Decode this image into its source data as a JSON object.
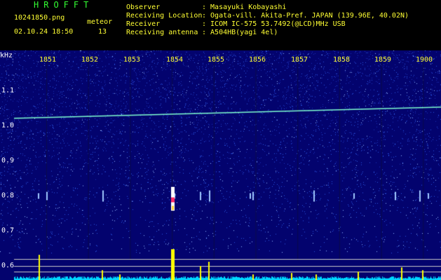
{
  "header": {
    "brand": "HROFFT",
    "filename": "10241850.png",
    "datetime": "02.10.24 18:50",
    "meteor_label": "meteor",
    "meteor_count": "13",
    "fields": [
      {
        "label": "Observer",
        "value": ": Masayuki Kobayashi"
      },
      {
        "label": "Receiving Location",
        "value": ": Ogata-vill. Akita-Pref. JAPAN (139.96E, 40.02N)"
      },
      {
        "label": "Receiver",
        "value": ": ICOM IC-575 53.7492(@LCD)MHz USB"
      },
      {
        "label": "Receiving antenna",
        "value": ": A504HB(yagi 4el)"
      }
    ]
  },
  "spectrogram": {
    "y_unit": "kHz",
    "y_ticks": [
      "1.1",
      "1.0",
      "0.9",
      "0.8",
      "0.7",
      "0.6"
    ],
    "x_ticks": [
      "1851",
      "1852",
      "1853",
      "1854",
      "1855",
      "1856",
      "1857",
      "1858",
      "1859",
      "1900"
    ],
    "colors": {
      "background": "#03036e",
      "noise": "#2a55e0",
      "carrier": "#7fffd0",
      "meteor_core": "#ff2a6a",
      "meteor_halo": "#ffffff",
      "amplitude": "#ffff00",
      "baseline": "#00d8ff",
      "label": "#ffff33"
    }
  }
}
